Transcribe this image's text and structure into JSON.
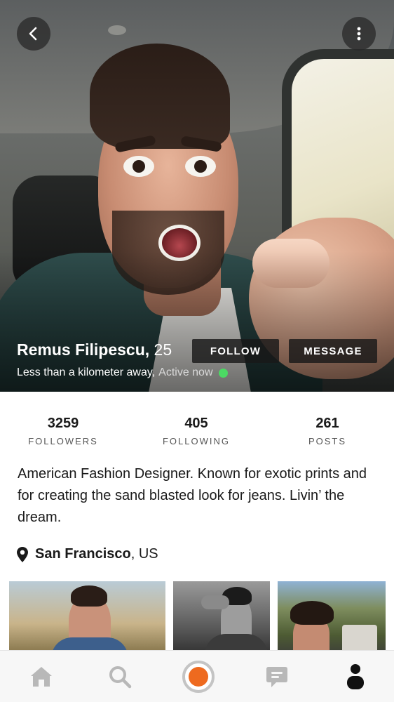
{
  "profile": {
    "name": "Remus Filipescu,",
    "age": " 25",
    "distance": "Less than a kilometer away,",
    "status": "Active now",
    "online_color": "#4cd964"
  },
  "actions": {
    "follow_label": "FOLLOW",
    "message_label": "MESSAGE"
  },
  "top_bar": {
    "back_icon": "chevron-left-icon",
    "more_icon": "vertical-dots-icon"
  },
  "stats": [
    {
      "value": "3259",
      "label": "FOLLOWERS"
    },
    {
      "value": "405",
      "label": "FOLLOWING"
    },
    {
      "value": "261",
      "label": "POSTS"
    }
  ],
  "bio": "American Fashion Designer. Known for exotic prints and for creating the sand blasted look for jeans. Livin’ the dream.",
  "location": {
    "city": "San Francisco",
    "country": ", US",
    "icon": "map-pin-icon"
  },
  "photos": [
    {
      "icon": "photo-thumbnail"
    },
    {
      "icon": "photo-thumbnail"
    },
    {
      "icon": "photo-thumbnail"
    }
  ],
  "tabbar": {
    "items": [
      {
        "icon": "home-icon"
      },
      {
        "icon": "search-icon"
      },
      {
        "icon": "record-icon"
      },
      {
        "icon": "chat-icon"
      },
      {
        "icon": "profile-icon"
      }
    ],
    "accent": "#ee6a1f",
    "inactive": "#b8b8b8",
    "active": "#111111"
  }
}
